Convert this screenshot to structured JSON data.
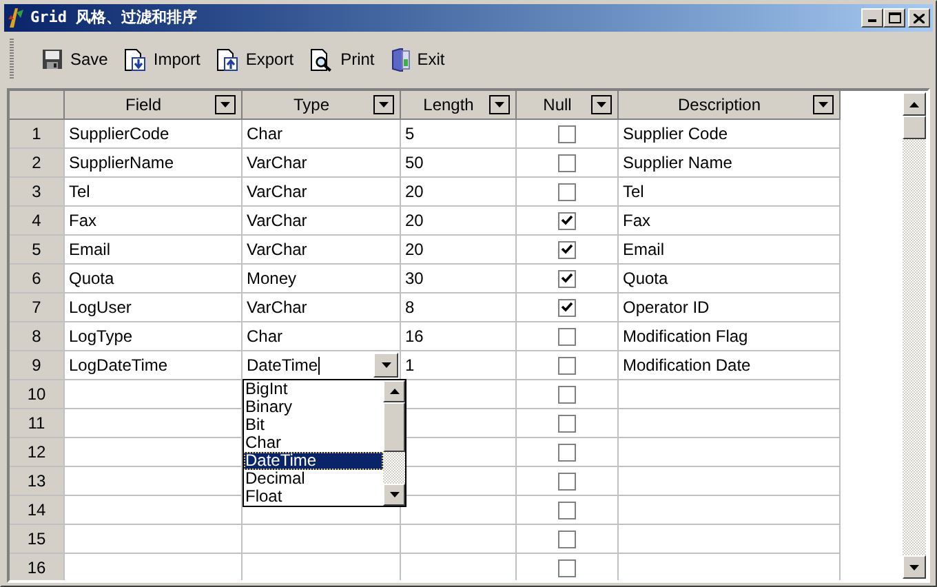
{
  "window": {
    "title": "Grid 风格、过滤和排序"
  },
  "toolbar": [
    {
      "kind": "save",
      "label": "Save"
    },
    {
      "kind": "import",
      "label": "Import"
    },
    {
      "kind": "export",
      "label": "Export"
    },
    {
      "kind": "print",
      "label": "Print"
    },
    {
      "kind": "exit",
      "label": "Exit"
    }
  ],
  "table": {
    "columns": [
      "Field",
      "Type",
      "Length",
      "Null",
      "Description"
    ],
    "rows": [
      {
        "number": "1",
        "field": "SupplierCode",
        "type": "Char",
        "length": "5",
        "null": false,
        "description": "Supplier Code",
        "editing": false
      },
      {
        "number": "2",
        "field": "SupplierName",
        "type": "VarChar",
        "length": "50",
        "null": false,
        "description": "Supplier Name",
        "editing": false
      },
      {
        "number": "3",
        "field": "Tel",
        "type": "VarChar",
        "length": "20",
        "null": false,
        "description": "Tel",
        "editing": false
      },
      {
        "number": "4",
        "field": "Fax",
        "type": "VarChar",
        "length": "20",
        "null": true,
        "description": "Fax",
        "editing": false
      },
      {
        "number": "5",
        "field": "Email",
        "type": "VarChar",
        "length": "20",
        "null": true,
        "description": "Email",
        "editing": false
      },
      {
        "number": "6",
        "field": "Quota",
        "type": "Money",
        "length": "30",
        "null": true,
        "description": "Quota",
        "editing": false
      },
      {
        "number": "7",
        "field": "LogUser",
        "type": "VarChar",
        "length": "8",
        "null": true,
        "description": "Operator ID",
        "editing": false
      },
      {
        "number": "8",
        "field": "LogType",
        "type": "Char",
        "length": "16",
        "null": false,
        "description": "Modification Flag",
        "editing": false
      },
      {
        "number": "9",
        "field": "LogDateTime",
        "type": "DateTime",
        "length": "1",
        "null": false,
        "description": "Modification Date",
        "editing": true
      },
      {
        "number": "10",
        "null": false,
        "editing": false
      },
      {
        "number": "11",
        "null": false,
        "editing": false
      },
      {
        "number": "12",
        "null": false,
        "editing": false
      },
      {
        "number": "13",
        "null": false,
        "editing": false
      },
      {
        "number": "14",
        "null": false,
        "editing": false
      },
      {
        "number": "15",
        "null": false,
        "editing": false
      },
      {
        "number": "16",
        "null": false,
        "editing": false
      }
    ]
  },
  "type_dropdown": {
    "options": [
      {
        "label": "BigInt",
        "selected": false
      },
      {
        "label": "Binary",
        "selected": false
      },
      {
        "label": "Bit",
        "selected": false
      },
      {
        "label": "Char",
        "selected": false
      },
      {
        "label": "DateTime",
        "selected": true
      },
      {
        "label": "Decimal",
        "selected": false
      },
      {
        "label": "Float",
        "selected": false
      }
    ]
  }
}
